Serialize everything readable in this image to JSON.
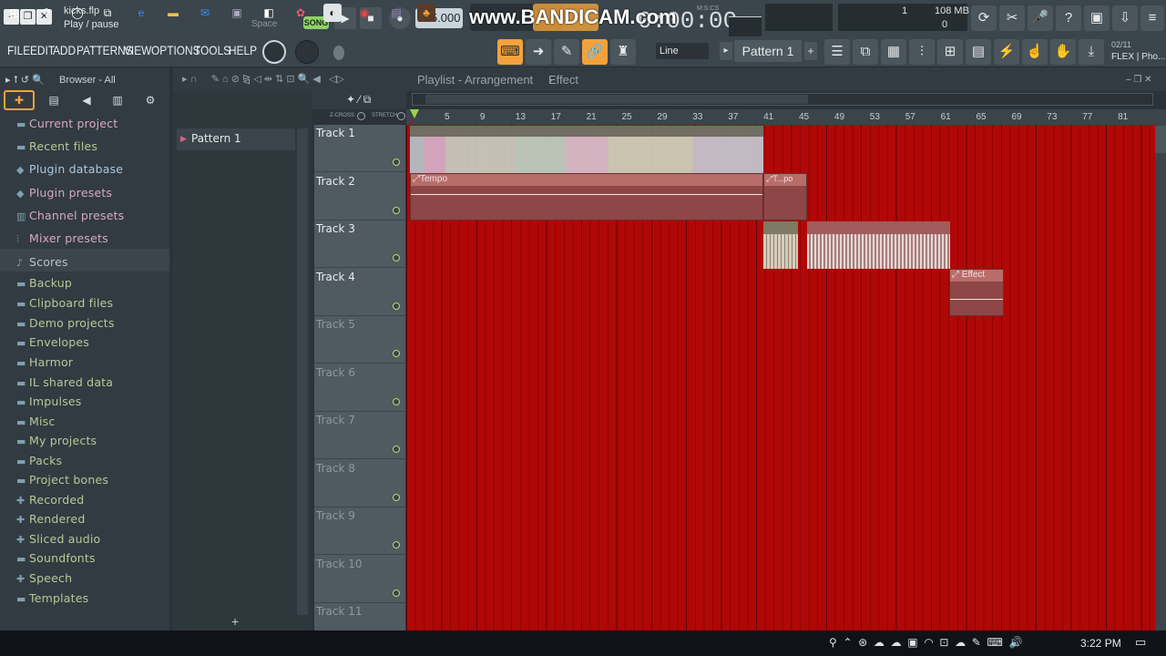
{
  "window": {
    "filename": "kicks.flp",
    "hint": "Play / pause",
    "hint_key": "Space"
  },
  "transport": {
    "song_label": "SONG",
    "tempo": "155.000",
    "time_display": "0:00:00",
    "time_format": "M:S:CS",
    "memory": "108 MB",
    "cpu": "0",
    "voices": "1"
  },
  "watermark": "www.BANDICAM.com",
  "menu": [
    "FILE",
    "EDIT",
    "ADD",
    "PATTERNS",
    "VIEW",
    "OPTIONS",
    "TOOLS",
    "HELP"
  ],
  "snap_mode": "Line",
  "pattern_selector": "Pattern 1",
  "news": {
    "date": "02/11",
    "text": "FLEX | Pho..."
  },
  "browser": {
    "title": "Browser - All",
    "items": [
      {
        "label": "Current project",
        "icon": "folder-icon",
        "color": "pink"
      },
      {
        "label": "Recent files",
        "icon": "folder-icon",
        "color": "normal"
      },
      {
        "label": "Plugin database",
        "icon": "plug-icon",
        "color": "blue"
      },
      {
        "label": "Plugin presets",
        "icon": "plug-icon",
        "color": "pink"
      },
      {
        "label": "Channel presets",
        "icon": "channel-icon",
        "color": "pink"
      },
      {
        "label": "Mixer presets",
        "icon": "mixer-icon",
        "color": "pink"
      },
      {
        "label": "Scores",
        "icon": "note-icon",
        "color": "gray"
      },
      {
        "label": "Backup",
        "icon": "folder-icon",
        "color": "normal"
      },
      {
        "label": "Clipboard files",
        "icon": "folder-icon",
        "color": "normal"
      },
      {
        "label": "Demo projects",
        "icon": "folder-icon",
        "color": "normal"
      },
      {
        "label": "Envelopes",
        "icon": "folder-icon",
        "color": "normal"
      },
      {
        "label": "Harmor",
        "icon": "folder-icon",
        "color": "normal"
      },
      {
        "label": "IL shared data",
        "icon": "folder-icon",
        "color": "normal"
      },
      {
        "label": "Impulses",
        "icon": "folder-icon",
        "color": "normal"
      },
      {
        "label": "Misc",
        "icon": "folder-icon",
        "color": "normal"
      },
      {
        "label": "My projects",
        "icon": "folder-icon",
        "color": "normal"
      },
      {
        "label": "Packs",
        "icon": "folder-icon",
        "color": "normal"
      },
      {
        "label": "Project bones",
        "icon": "folder-icon",
        "color": "normal"
      },
      {
        "label": "Recorded",
        "icon": "recorded-icon",
        "color": "normal"
      },
      {
        "label": "Rendered",
        "icon": "rendered-icon",
        "color": "normal"
      },
      {
        "label": "Sliced audio",
        "icon": "sliced-icon",
        "color": "normal"
      },
      {
        "label": "Soundfonts",
        "icon": "folder-icon",
        "color": "normal"
      },
      {
        "label": "Speech",
        "icon": "speech-icon",
        "color": "normal"
      },
      {
        "label": "Templates",
        "icon": "folder-icon",
        "color": "normal"
      }
    ]
  },
  "patterns": [
    {
      "label": "Pattern 1"
    }
  ],
  "playlist": {
    "breadcrumb": "Playlist - Arrangement",
    "breadcrumb_sub": "Effect",
    "zcross_label": "Z-CROSS",
    "stretch_label": "STRETCH",
    "ruler": [
      "5",
      "9",
      "13",
      "17",
      "21",
      "25",
      "29",
      "33",
      "37",
      "41",
      "45",
      "49",
      "53",
      "57",
      "61",
      "65",
      "69",
      "73",
      "77",
      "81"
    ],
    "tracks": [
      "Track 1",
      "Track 2",
      "Track 3",
      "Track 4",
      "Track 5",
      "Track 6",
      "Track 7",
      "Track 8",
      "Track 9",
      "Track 10",
      "Track 11"
    ],
    "clips": [
      {
        "label": "",
        "kind": "audio"
      },
      {
        "label": "Tempo",
        "kind": "automation"
      },
      {
        "label": "T...po",
        "kind": "automation"
      },
      {
        "label": "",
        "kind": "audio"
      },
      {
        "label": "",
        "kind": "audio"
      },
      {
        "label": "Effect",
        "kind": "automation"
      }
    ]
  },
  "taskbar": {
    "time": "3:22 PM"
  }
}
